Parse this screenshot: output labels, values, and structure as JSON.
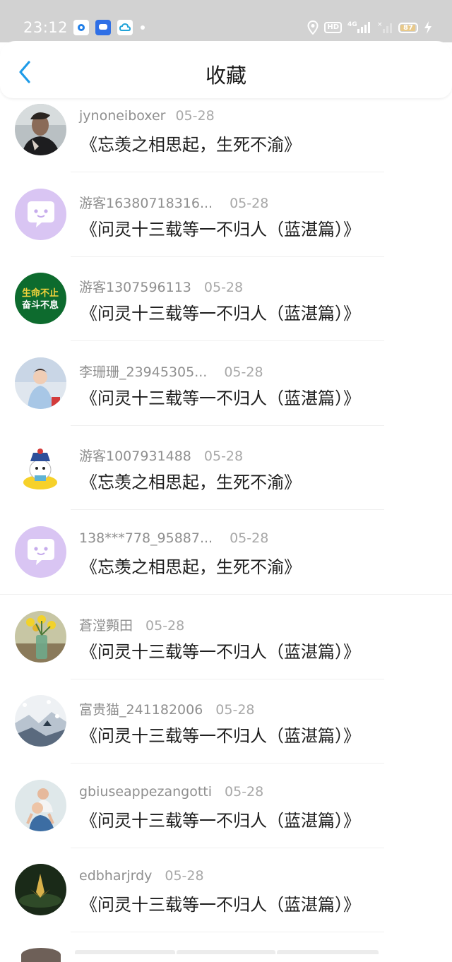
{
  "status_bar": {
    "time": "23:12",
    "hd_label": "HD",
    "network": "4G",
    "battery_level": "87",
    "notification_icons": [
      "blue-square-app-icon",
      "chat-bubble-app-icon",
      "cloud-app-icon"
    ]
  },
  "header": {
    "title": "收藏"
  },
  "favorites": [
    {
      "username": "jynoneiboxer",
      "date": "05-28",
      "title": "《忘羡之相思起，生死不渝》",
      "avatar": "man-portrait"
    },
    {
      "username": "游客16380718316...",
      "date": "05-28",
      "title": "《问灵十三载等一不归人（蓝湛篇）》",
      "avatar": "default-chat"
    },
    {
      "username": "游客1307596113",
      "date": "05-28",
      "title": "《问灵十三载等一不归人（蓝湛篇）》",
      "avatar": "green-slogan"
    },
    {
      "username": "李珊珊_23945305...",
      "date": "05-28",
      "title": "《问灵十三载等一不归人（蓝湛篇）》",
      "avatar": "child-photo"
    },
    {
      "username": "游客1007931488",
      "date": "05-28",
      "title": "《忘羡之相思起，生死不渝》",
      "avatar": "cartoon-duck"
    },
    {
      "username": "138***778_95887...",
      "date": "05-28",
      "title": "《忘羡之相思起，生死不渝》",
      "avatar": "default-chat"
    },
    {
      "username": "蒼漟顭田",
      "date": "05-28",
      "title": "《问灵十三载等一不归人（蓝湛篇）》",
      "avatar": "flower-vase"
    },
    {
      "username": "富贵猫_241182006",
      "date": "05-28",
      "title": "《问灵十三载等一不归人（蓝湛篇）》",
      "avatar": "snow-scene"
    },
    {
      "username": "gbiuseappezangotti",
      "date": "05-28",
      "title": "《问灵十三载等一不归人（蓝湛篇）》",
      "avatar": "family-photo"
    },
    {
      "username": "edbharjrdy",
      "date": "05-28",
      "title": "《问灵十三载等一不归人（蓝湛篇）》",
      "avatar": "dark-lotus"
    }
  ],
  "slogan": {
    "line1": "生命不止",
    "line2": "奋斗不息"
  },
  "colors": {
    "accent": "#1e9be8",
    "status_bar_bg": "#d2d2d2",
    "default_avatar_bg": "#d9c5f3",
    "slogan_bg": "#0d6b2e"
  }
}
